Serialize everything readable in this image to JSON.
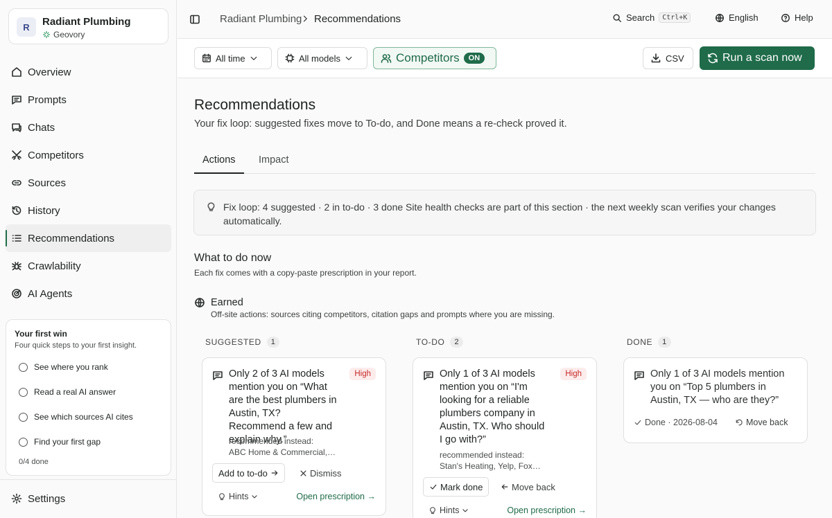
{
  "account": {
    "initial": "R",
    "name": "Radiant Plumbing",
    "workspace": "Geovory"
  },
  "sidebar": {
    "items": [
      {
        "label": "Overview",
        "icon": "home-icon"
      },
      {
        "label": "Prompts",
        "icon": "message-icon"
      },
      {
        "label": "Chats",
        "icon": "chat-icon"
      },
      {
        "label": "Competitors",
        "icon": "swords-icon"
      },
      {
        "label": "Sources",
        "icon": "link-icon"
      },
      {
        "label": "History",
        "icon": "history-icon"
      },
      {
        "label": "Recommendations",
        "icon": "list-icon",
        "active": true
      },
      {
        "label": "Crawlability",
        "icon": "spider-icon"
      },
      {
        "label": "AI Agents",
        "icon": "radar-icon"
      }
    ],
    "settings_label": "Settings"
  },
  "first_win": {
    "title": "Your first win",
    "subtitle": "Four quick steps to your first insight.",
    "steps": [
      "See where you rank",
      "Read a real AI answer",
      "See which sources AI cites",
      "Find your first gap"
    ],
    "progress": "0/4 done"
  },
  "topbar": {
    "breadcrumb_parent": "Radiant Plumbing",
    "breadcrumb_current": "Recommendations",
    "search_label": "Search",
    "search_shortcut": "Ctrl+K",
    "language": "English",
    "help": "Help"
  },
  "filters": {
    "time": "All time",
    "models": "All models",
    "competitors": "Competitors",
    "competitors_state": "ON",
    "csv": "CSV",
    "run_scan": "Run a scan now"
  },
  "page": {
    "title": "Recommendations",
    "subtitle": "Your fix loop: suggested fixes move to To-do, and Done means a re-check proved it.",
    "tabs": [
      "Actions",
      "Impact"
    ],
    "fixloop": "Fix loop: 4 suggested · 2 in to-do · 3 done  Site health checks are part of this section · the next weekly scan verifies your changes automatically.",
    "section_title": "What to do now",
    "section_sub": "Each fix comes with a copy-paste prescription in your report.",
    "earned_title": "Earned",
    "earned_sub": "Off-site actions: sources citing competitors, citation gaps and prompts where you are missing."
  },
  "columns": {
    "suggested": {
      "label": "SUGGESTED",
      "count": "1"
    },
    "todo": {
      "label": "TO-DO",
      "count": "2"
    },
    "done": {
      "label": "DONE",
      "count": "1"
    }
  },
  "cards": {
    "suggested": {
      "title": "Only 2 of 3 AI models mention you on “What are the best plumbers in Austin, TX? Recommend a few and explain why.”",
      "badge": "High",
      "rec_label": "recommended instead:",
      "rec_value": "ABC Home & Commercial, …",
      "add_label": "Add to to-do",
      "dismiss_label": "Dismiss",
      "hints_label": "Hints",
      "prescription_label": "Open prescription"
    },
    "todo": {
      "title": "Only 1 of 3 AI models mention you on “I'm looking for a reliable plumbers company in Austin, TX. Who should I go with?”",
      "badge": "High",
      "rec_label": "recommended instead:",
      "rec_value": "Stan's Heating, Yelp, Fox…",
      "mark_done_label": "Mark done",
      "move_back_label": "Move back",
      "hints_label": "Hints",
      "prescription_label": "Open prescription"
    },
    "done": {
      "title": "Only 1 of 3 AI models mention you on “Top 5 plumbers in Austin, TX — who are they?”",
      "done_meta": "Done · 2026-08-04",
      "move_back_label": "Move back"
    }
  }
}
